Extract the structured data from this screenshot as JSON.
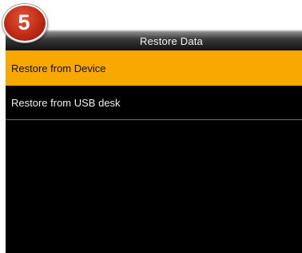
{
  "step_badge": {
    "number": "5",
    "color": "#c02a14"
  },
  "screen": {
    "title": "Restore Data",
    "accent_color": "#f8a800",
    "menu_items": [
      {
        "label": "Restore from Device",
        "selected": true
      },
      {
        "label": "Restore from USB desk",
        "selected": false
      }
    ]
  }
}
